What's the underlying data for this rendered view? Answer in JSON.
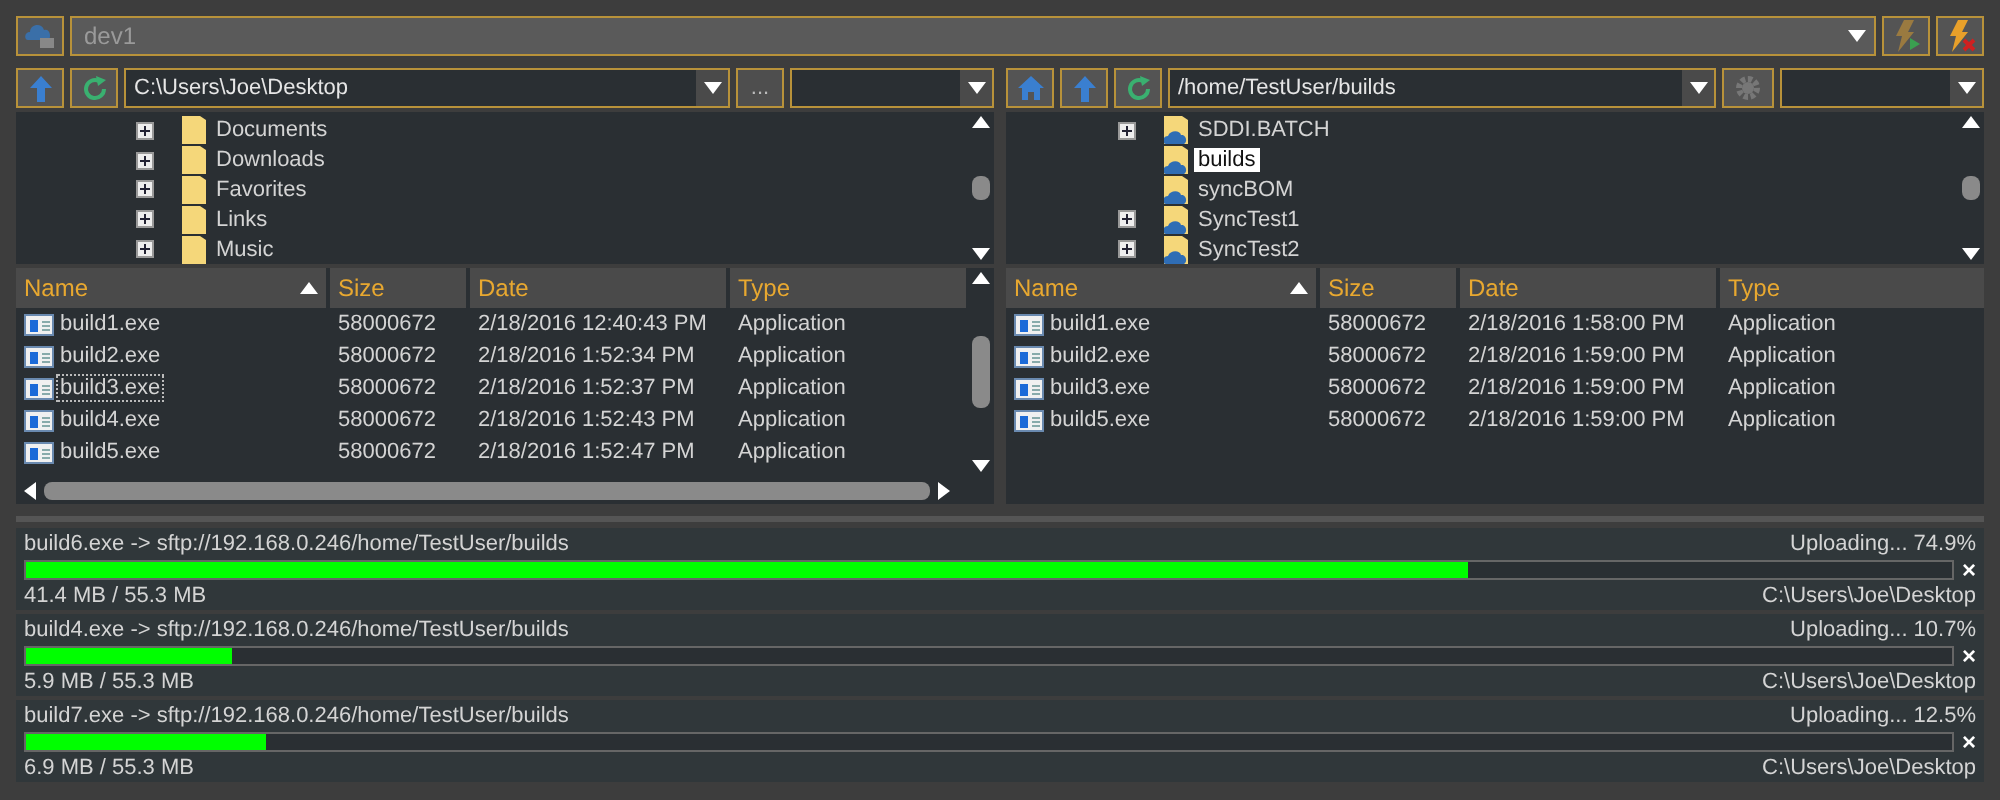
{
  "connection": {
    "value": "dev1"
  },
  "panes": [
    {
      "kind": "local",
      "path": "C:\\Users\\Joe\\Desktop",
      "browse_label": "...",
      "tree": [
        {
          "label": "Documents",
          "expandable": true,
          "selected": false
        },
        {
          "label": "Downloads",
          "expandable": true,
          "selected": false
        },
        {
          "label": "Favorites",
          "expandable": true,
          "selected": false
        },
        {
          "label": "Links",
          "expandable": true,
          "selected": false
        },
        {
          "label": "Music",
          "expandable": true,
          "selected": false
        }
      ],
      "columns": [
        "Name",
        "Size",
        "Date",
        "Type"
      ],
      "rows": [
        {
          "name": "build1.exe",
          "size": "58000672",
          "date": "2/18/2016 12:40:43 PM",
          "type": "Application",
          "focused": false
        },
        {
          "name": "build2.exe",
          "size": "58000672",
          "date": "2/18/2016 1:52:34 PM",
          "type": "Application",
          "focused": false
        },
        {
          "name": "build3.exe",
          "size": "58000672",
          "date": "2/18/2016 1:52:37 PM",
          "type": "Application",
          "focused": true
        },
        {
          "name": "build4.exe",
          "size": "58000672",
          "date": "2/18/2016 1:52:43 PM",
          "type": "Application",
          "focused": false
        },
        {
          "name": "build5.exe",
          "size": "58000672",
          "date": "2/18/2016 1:52:47 PM",
          "type": "Application",
          "focused": false
        }
      ]
    },
    {
      "kind": "remote",
      "path": "/home/TestUser/builds",
      "tree": [
        {
          "label": "SDDI.BATCH",
          "expandable": true,
          "selected": false
        },
        {
          "label": "builds",
          "expandable": false,
          "selected": true
        },
        {
          "label": "syncBOM",
          "expandable": false,
          "selected": false
        },
        {
          "label": "SyncTest1",
          "expandable": true,
          "selected": false
        },
        {
          "label": "SyncTest2",
          "expandable": true,
          "selected": false
        }
      ],
      "columns": [
        "Name",
        "Size",
        "Date",
        "Type"
      ],
      "rows": [
        {
          "name": "build1.exe",
          "size": "58000672",
          "date": "2/18/2016 1:58:00 PM",
          "type": "Application",
          "focused": false
        },
        {
          "name": "build2.exe",
          "size": "58000672",
          "date": "2/18/2016 1:59:00 PM",
          "type": "Application",
          "focused": false
        },
        {
          "name": "build3.exe",
          "size": "58000672",
          "date": "2/18/2016 1:59:00 PM",
          "type": "Application",
          "focused": false
        },
        {
          "name": "build5.exe",
          "size": "58000672",
          "date": "2/18/2016 1:59:00 PM",
          "type": "Application",
          "focused": false
        }
      ]
    }
  ],
  "transfers": [
    {
      "title": "build6.exe -> sftp://192.168.0.246/home/TestUser/builds",
      "status": "Uploading... 74.9%",
      "level": 0.749,
      "progress": "41.4 MB / 55.3 MB",
      "source": "C:\\Users\\Joe\\Desktop",
      "cancel": "×"
    },
    {
      "title": "build4.exe -> sftp://192.168.0.246/home/TestUser/builds",
      "status": "Uploading... 10.7%",
      "level": 0.107,
      "progress": "5.9 MB / 55.3 MB",
      "source": "C:\\Users\\Joe\\Desktop",
      "cancel": "×"
    },
    {
      "title": "build7.exe -> sftp://192.168.0.246/home/TestUser/builds",
      "status": "Uploading... 12.5%",
      "level": 0.125,
      "progress": "6.9 MB / 55.3 MB",
      "source": "C:\\Users\\Joe\\Desktop",
      "cancel": "×"
    }
  ]
}
